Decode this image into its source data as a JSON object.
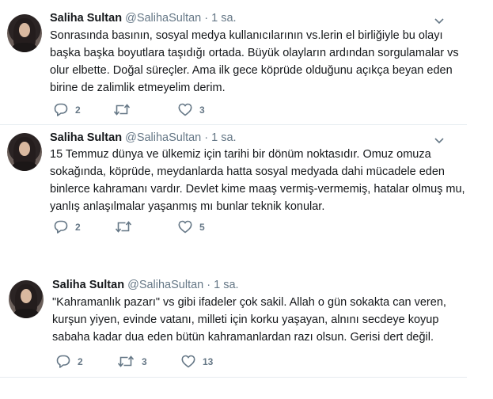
{
  "tweets": [
    {
      "name": "Saliha Sultan",
      "handle": "@SalihaSultan",
      "dot": "·",
      "time": "1 sa.",
      "lines": [
        "Sonrasında basının, sosyal medya kullanıcılarının vs.lerin el birliğiyle bu olayı",
        "başka başka boyutlara taşıdığı ortada. Büyük olayların ardından sorgulamalar vs",
        "olur elbette. Doğal süreçler. Ama ilk gece köprüde olduğunu açıkça beyan eden",
        "birine de zalimlik etmeyelim derim."
      ],
      "reply_count": "2",
      "retweet_count": "",
      "like_count": "3"
    },
    {
      "name": "Saliha Sultan",
      "handle": "@SalihaSultan",
      "dot": "·",
      "time": "1 sa.",
      "lines": [
        "15 Temmuz dünya ve ülkemiz için tarihi bir dönüm noktasıdır. Omuz omuza",
        "sokağında, köprüde, meydanlarda hatta sosyal medyada dahi mücadele eden",
        "binlerce kahramanı vardır. Devlet kime maaş vermiş-vermemiş, hatalar olmuş mu,",
        "yanlış anlaşılmalar yaşanmış mı bunlar teknik konular."
      ],
      "reply_count": "2",
      "retweet_count": "",
      "like_count": "5"
    },
    {
      "name": "Saliha Sultan",
      "handle": "@SalihaSultan",
      "dot": "·",
      "time": "1 sa.",
      "lines": [
        "\"Kahramanlık pazarı\" vs gibi ifadeler çok sakil. Allah o gün sokakta can veren,",
        "kurşun yiyen, evinde vatanı, milleti için korku yaşayan, alnını secdeye koyup",
        "sabaha kadar dua eden bütün kahramanlardan razı olsun.  Gerisi dert değil."
      ],
      "reply_count": "2",
      "retweet_count": "3",
      "like_count": "13"
    }
  ],
  "icons": {
    "reply": "reply-icon",
    "retweet": "retweet-icon",
    "like": "heart-icon",
    "menu": "chevron-down-icon",
    "avatar": "profile-photo"
  },
  "colors": {
    "muted": "#657786",
    "text": "#14171a",
    "divider": "#e6ecf0"
  }
}
